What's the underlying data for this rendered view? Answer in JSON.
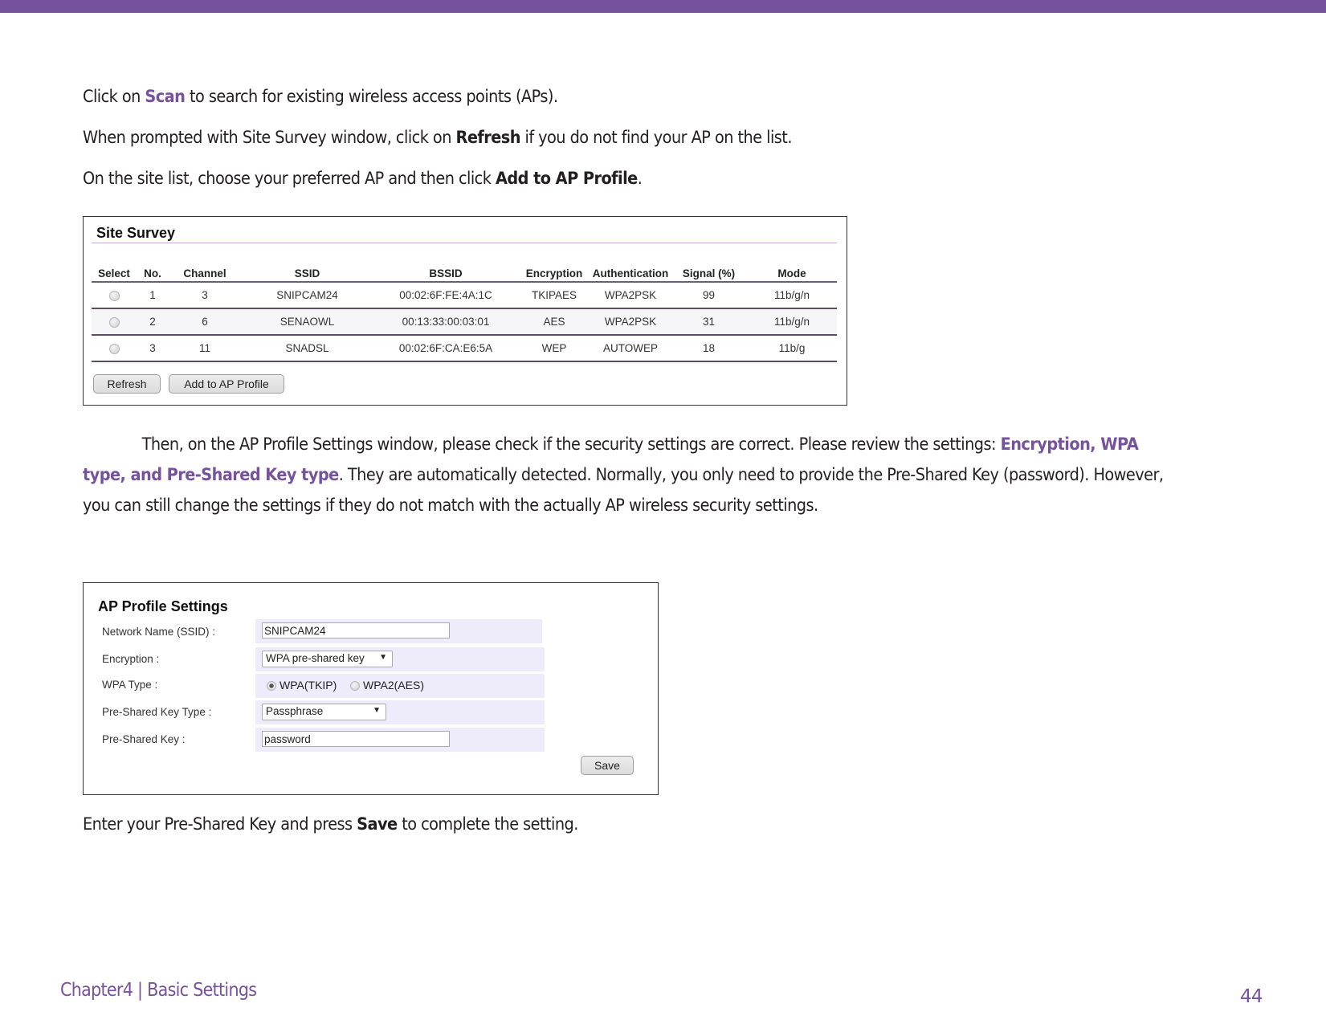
{
  "header": {
    "bar_color": "#77529c"
  },
  "instructions": {
    "line1": {
      "pre": "Click on ",
      "highlight": "Scan",
      "post": " to search for existing wireless access points (APs)."
    },
    "line2": {
      "pre": "When prompted with Site Survey window, click on ",
      "bold": "Refresh",
      "post": " if you do not find your AP on the list."
    },
    "line3": {
      "pre": "On the site list, choose your preferred AP and then click ",
      "bold": "Add to AP Profile",
      "post": "."
    }
  },
  "site_survey": {
    "title": "Site Survey",
    "columns": [
      "Select",
      "No.",
      "Channel",
      "SSID",
      "BSSID",
      "Encryption",
      "Authentication",
      "Signal (%)",
      "Mode"
    ],
    "rows": [
      {
        "no": "1",
        "channel": "3",
        "ssid": "SNIPCAM24",
        "bssid": "00:02:6F:FE:4A:1C",
        "encryption": "TKIPAES",
        "authentication": "WPA2PSK",
        "signal": "99",
        "mode": "11b/g/n"
      },
      {
        "no": "2",
        "channel": "6",
        "ssid": "SENAOWL",
        "bssid": "00:13:33:00:03:01",
        "encryption": "AES",
        "authentication": "WPA2PSK",
        "signal": "31",
        "mode": "11b/g/n"
      },
      {
        "no": "3",
        "channel": "11",
        "ssid": "SNADSL",
        "bssid": "00:02:6F:CA:E6:5A",
        "encryption": "WEP",
        "authentication": "AUTOWEP",
        "signal": "18",
        "mode": "11b/g"
      }
    ],
    "refresh_label": "Refresh",
    "add_label": "Add to AP Profile"
  },
  "paragraph": {
    "part1": "Then, on the AP Profile Settings window, please check if the security settings are correct. Please review the settings: ",
    "highlight": "Encryption, WPA type, and Pre-Shared Key type",
    "part2": ". They are automatically detected. Normally, you only need to provide the Pre-Shared Key (password). However, you can still change the settings if they do not match with the actually AP wireless security settings."
  },
  "ap_profile": {
    "title": "AP Profile Settings",
    "ssid_label": "Network Name (SSID) :",
    "ssid_value": "SNIPCAM24",
    "encryption_label": "Encryption :",
    "encryption_value": "WPA pre-shared key",
    "wpa_type_label": "WPA Type :",
    "wpa_options": [
      "WPA(TKIP)",
      "WPA2(AES)"
    ],
    "wpa_selected": "WPA(TKIP)",
    "psk_type_label": "Pre-Shared Key Type :",
    "psk_type_value": "Passphrase",
    "psk_label": "Pre-Shared Key :",
    "psk_value": "password",
    "save_label": "Save"
  },
  "closing": {
    "pre": "Enter your Pre-Shared Key and press ",
    "bold": "Save",
    "post": " to complete the setting."
  },
  "footer": {
    "chapter": "Chapter4  |  Basic Settings",
    "page_number": "44"
  }
}
